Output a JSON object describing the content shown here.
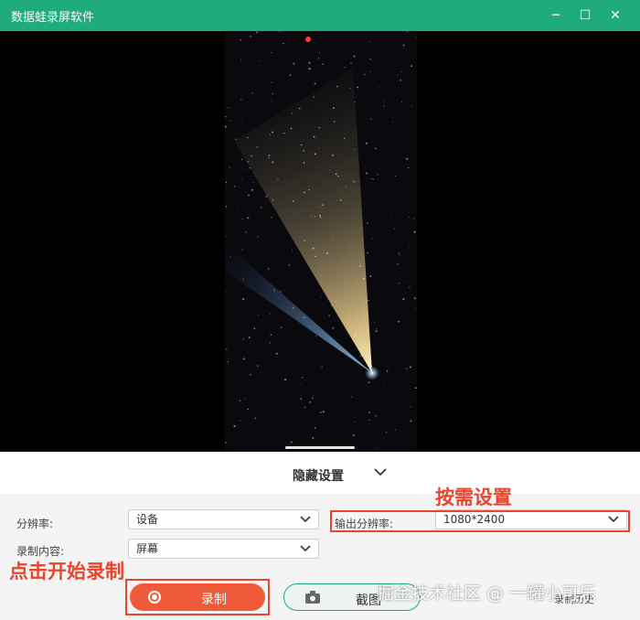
{
  "window": {
    "title": "数据蛙录屏软件",
    "minimize_glyph": "─",
    "maximize_glyph": "☐",
    "close_glyph": "✕"
  },
  "preview": {
    "recording_indicator_color": "#ff3b30"
  },
  "settings": {
    "hide_settings_label": "隐藏设置",
    "resolution_label": "分辨率:",
    "resolution_value": "设备",
    "content_label": "录制内容:",
    "content_value": "屏幕",
    "output_resolution_label": "输出分辨率:",
    "output_resolution_value": "1080*2400"
  },
  "actions": {
    "record_label": "录制",
    "screenshot_label": "截图",
    "history_label": "录制历史"
  },
  "annotations": {
    "set_as_needed": "按需设置",
    "click_to_start": "点击开始录制"
  },
  "watermark": "掘金技术社区 @ 一罐小可乐",
  "colors": {
    "brand": "#1fab7a",
    "record": "#ee5a3a",
    "annotation": "#e8452c"
  },
  "icons": [
    "minimize-icon",
    "maximize-icon",
    "close-icon",
    "chevron-down-icon",
    "record-icon",
    "camera-icon"
  ]
}
